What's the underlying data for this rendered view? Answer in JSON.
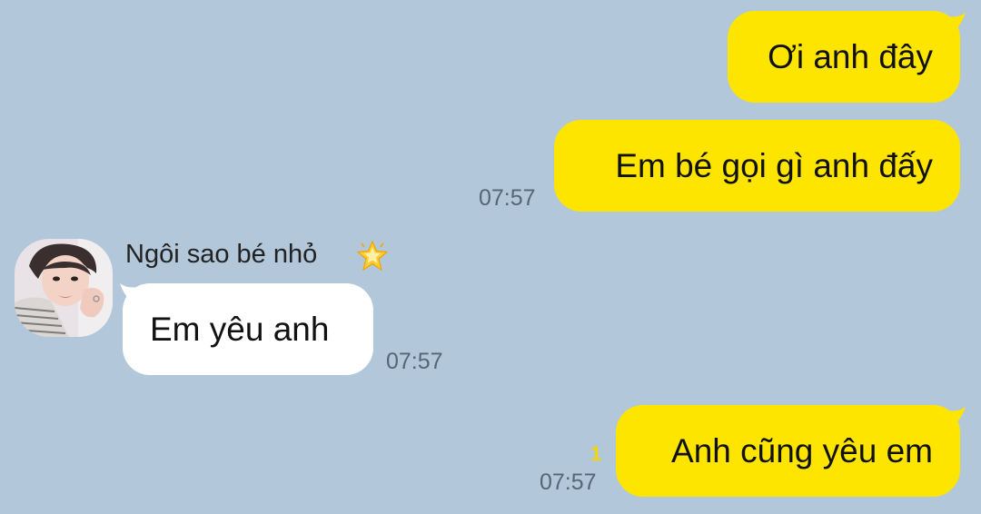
{
  "conversation": {
    "messages": [
      {
        "direction": "outgoing",
        "text": "Ơi anh đây"
      },
      {
        "direction": "outgoing",
        "text": "Em bé gọi gì anh đấy",
        "time": "07:57"
      },
      {
        "direction": "incoming",
        "sender": "Ngôi sao bé nhỏ",
        "sender_icon": "glowing-star-icon",
        "text": "Em yêu anh",
        "time": "07:57"
      },
      {
        "direction": "outgoing",
        "text": "Anh cũng yêu em",
        "time": "07:57",
        "unread_count": "1"
      }
    ]
  },
  "colors": {
    "background": "#b2c7d9",
    "outgoing_bubble": "#fee500",
    "incoming_bubble": "#ffffff",
    "unread": "#f2d600"
  }
}
